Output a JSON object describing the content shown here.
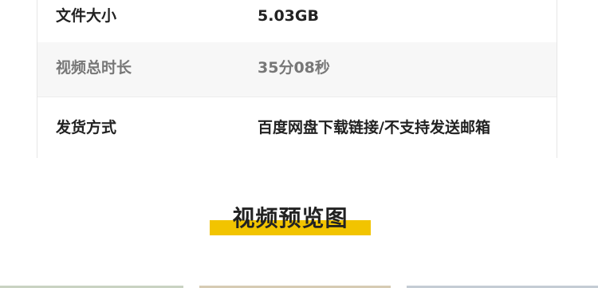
{
  "info_table": {
    "rows": [
      {
        "label": "文件大小",
        "value": "5.03GB"
      },
      {
        "label": "视频总时长",
        "value": "35分08秒"
      },
      {
        "label": "发货方式",
        "value": "百度网盘下载链接/不支持发送邮箱"
      }
    ]
  },
  "section": {
    "title": "视频预览图",
    "highlight_color": "#f2c400"
  }
}
